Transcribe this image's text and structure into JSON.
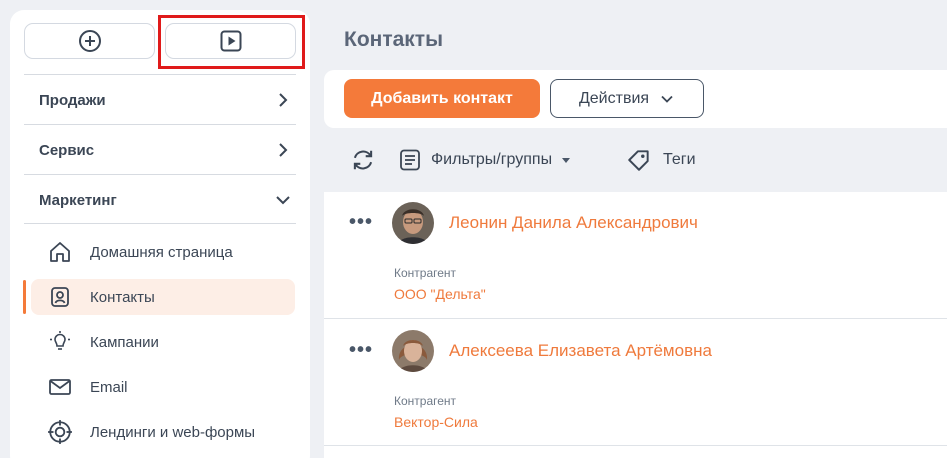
{
  "sidebar": {
    "sections": [
      {
        "label": "Продажи"
      },
      {
        "label": "Сервис"
      },
      {
        "label": "Маркетинг"
      }
    ],
    "items": [
      {
        "label": "Домашняя страница",
        "icon": "home-icon"
      },
      {
        "label": "Контакты",
        "icon": "contact-icon",
        "active": true
      },
      {
        "label": "Кампании",
        "icon": "lightbulb-icon"
      },
      {
        "label": "Email",
        "icon": "envelope-icon"
      },
      {
        "label": "Лендинги и web-формы",
        "icon": "target-icon"
      }
    ]
  },
  "main": {
    "title": "Контакты",
    "add_button": "Добавить контакт",
    "actions_button": "Действия",
    "filters_label": "Фильтры/группы",
    "tags_label": "Теги",
    "contacts": [
      {
        "name": "Леонин Данила Александрович",
        "org_label": "Контрагент",
        "org": "ООО \"Дельта\""
      },
      {
        "name": "Алексеева Елизавета Артёмовна",
        "org_label": "Контрагент",
        "org": "Вектор-Сила"
      }
    ]
  },
  "colors": {
    "accent": "#f47a3a",
    "highlight": "#e01a1a",
    "text": "#3b4655"
  }
}
